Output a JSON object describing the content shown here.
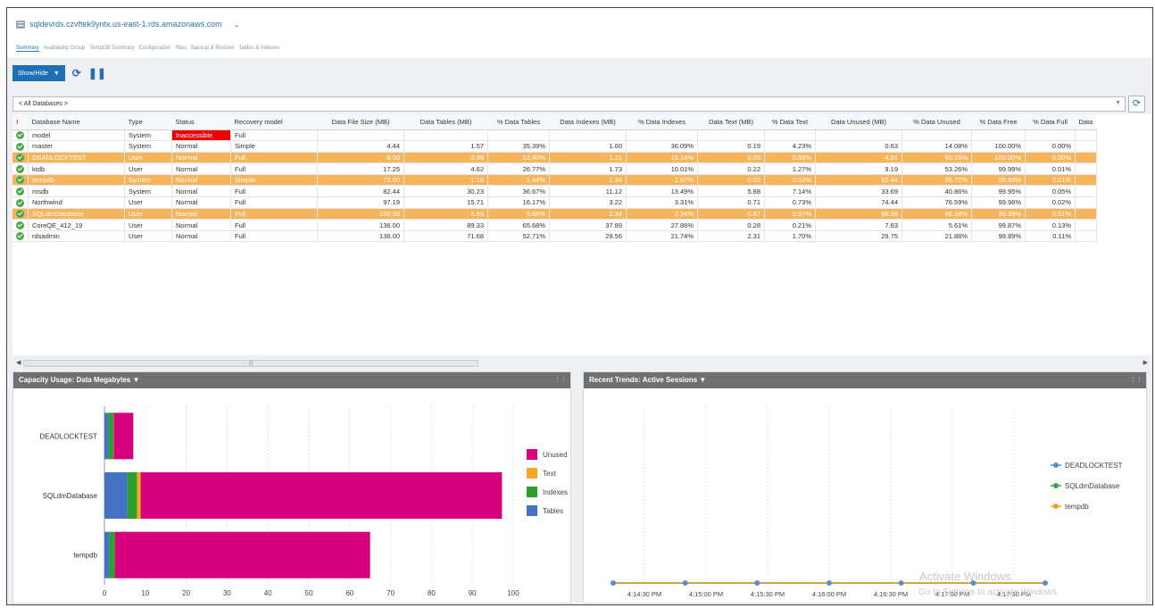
{
  "header": {
    "server": "sqldevrds.czvftek9yntx.us-east-1.rds.amazonaws.com",
    "tabs": [
      "Summary",
      "Availability Group",
      "TempDB Summary",
      "Configuration",
      "Files",
      "Backup & Restore",
      "Tables & Indexes"
    ],
    "active_tab": "Summary"
  },
  "toolbar": {
    "showhide_label": "Show/Hide",
    "refresh_icon": "refresh-icon",
    "pause_icon": "pause-icon"
  },
  "db_selector": {
    "value": "< All Databases >"
  },
  "table": {
    "columns": [
      "Database Name",
      "Type",
      "Status",
      "Recovery model",
      "Data File Size (MB)",
      "Data Tables (MB)",
      "% Data Tables",
      "Data Indexes (MB)",
      "% Data Indexes",
      "Data Text (MB)",
      "% Data Text",
      "Data Unused (MB)",
      "% Data Unused",
      "% Data Free",
      "% Data Full",
      "Data"
    ],
    "rows": [
      {
        "name": "model",
        "type": "System",
        "status": "Inaccessible",
        "recovery": "Full",
        "file_size": "",
        "tables": "",
        "pct_tables": "",
        "indexes": "",
        "pct_indexes": "",
        "text": "",
        "pct_text": "",
        "unused": "",
        "pct_unused": "",
        "pct_free": "",
        "pct_full": "",
        "highlight": false,
        "inaccessible": true
      },
      {
        "name": "master",
        "type": "System",
        "status": "Normal",
        "recovery": "Simple",
        "file_size": "4.44",
        "tables": "1.57",
        "pct_tables": "35.39%",
        "indexes": "1.60",
        "pct_indexes": "36.09%",
        "text": "0.19",
        "pct_text": "4.23%",
        "unused": "0.63",
        "pct_unused": "14.08%",
        "pct_free": "100.00%",
        "pct_full": "0.00%",
        "highlight": false
      },
      {
        "name": "DEADLOCKTEST",
        "type": "User",
        "status": "Normal",
        "recovery": "Full",
        "file_size": "8.00",
        "tables": "0.99",
        "pct_tables": "12.40%",
        "indexes": "1.21",
        "pct_indexes": "15.14%",
        "text": "0.05",
        "pct_text": "0.59%",
        "unused": "4.81",
        "pct_unused": "60.16%",
        "pct_free": "100.00%",
        "pct_full": "0.00%",
        "highlight": true
      },
      {
        "name": "ktdb",
        "type": "User",
        "status": "Normal",
        "recovery": "Full",
        "file_size": "17.25",
        "tables": "4.62",
        "pct_tables": "26.77%",
        "indexes": "1.73",
        "pct_indexes": "10.01%",
        "text": "0.22",
        "pct_text": "1.27%",
        "unused": "9.19",
        "pct_unused": "53.26%",
        "pct_free": "99.99%",
        "pct_full": "0.01%",
        "highlight": false
      },
      {
        "name": "tempdb",
        "type": "System",
        "status": "Normal",
        "recovery": "Simple",
        "file_size": "72.00",
        "tables": "1.18",
        "pct_tables": "1.64%",
        "indexes": "1.34",
        "pct_indexes": "1.87%",
        "text": "0.02",
        "pct_text": "0.03%",
        "unused": "62.44",
        "pct_unused": "86.72%",
        "pct_free": "99.99%",
        "pct_full": "0.01%",
        "highlight": true
      },
      {
        "name": "msdb",
        "type": "System",
        "status": "Normal",
        "recovery": "Full",
        "file_size": "82.44",
        "tables": "30.23",
        "pct_tables": "36.67%",
        "indexes": "11.12",
        "pct_indexes": "13.49%",
        "text": "5.88",
        "pct_text": "7.14%",
        "unused": "33.69",
        "pct_unused": "40.86%",
        "pct_free": "99.95%",
        "pct_full": "0.05%",
        "highlight": false
      },
      {
        "name": "Northwind",
        "type": "User",
        "status": "Normal",
        "recovery": "Full",
        "file_size": "97.19",
        "tables": "15.71",
        "pct_tables": "16.17%",
        "indexes": "3.22",
        "pct_indexes": "3.31%",
        "text": "0.71",
        "pct_text": "0.73%",
        "unused": "74.44",
        "pct_unused": "76.59%",
        "pct_free": "99.98%",
        "pct_full": "0.02%",
        "highlight": false
      },
      {
        "name": "SQLdmDatabase",
        "type": "User",
        "status": "Normal",
        "recovery": "Full",
        "file_size": "100.00",
        "tables": "5.65",
        "pct_tables": "5.65%",
        "indexes": "2.34",
        "pct_indexes": "2.34%",
        "text": "0.87",
        "pct_text": "0.87%",
        "unused": "88.38",
        "pct_unused": "88.38%",
        "pct_free": "99.99%",
        "pct_full": "0.01%",
        "highlight": true
      },
      {
        "name": "CoreQE_412_19",
        "type": "User",
        "status": "Normal",
        "recovery": "Full",
        "file_size": "136.00",
        "tables": "89.33",
        "pct_tables": "65.68%",
        "indexes": "37.89",
        "pct_indexes": "27.86%",
        "text": "0.28",
        "pct_text": "0.21%",
        "unused": "7.63",
        "pct_unused": "5.61%",
        "pct_free": "99.87%",
        "pct_full": "0.13%",
        "highlight": false
      },
      {
        "name": "rdsadmin",
        "type": "User",
        "status": "Normal",
        "recovery": "Full",
        "file_size": "136.00",
        "tables": "71.68",
        "pct_tables": "52.71%",
        "indexes": "29.56",
        "pct_indexes": "21.74%",
        "text": "2.31",
        "pct_text": "1.70%",
        "unused": "29.75",
        "pct_unused": "21.88%",
        "pct_free": "99.89%",
        "pct_full": "0.11%",
        "highlight": false
      }
    ]
  },
  "capacity_panel": {
    "title": "Capacity Usage: Data Megabytes"
  },
  "trends_panel": {
    "title": "Recent Trends: Active Sessions"
  },
  "chart_data": [
    {
      "type": "bar",
      "orientation": "horizontal",
      "stacked": true,
      "categories": [
        "DEADLOCKTEST",
        "SQLdmDatabase",
        "tempdb"
      ],
      "series": [
        {
          "name": "Tables",
          "color": "#4472c4",
          "values": [
            0.99,
            5.65,
            1.18
          ]
        },
        {
          "name": "Indexes",
          "color": "#2ca02c",
          "values": [
            1.21,
            2.34,
            1.34
          ]
        },
        {
          "name": "Text",
          "color": "#f5a623",
          "values": [
            0.05,
            0.87,
            0.02
          ]
        },
        {
          "name": "Unused",
          "color": "#d6007e",
          "values": [
            4.81,
            88.38,
            62.44
          ]
        }
      ],
      "xlim": [
        0,
        100
      ],
      "xticks": [
        0,
        10,
        20,
        30,
        40,
        50,
        60,
        70,
        80,
        90,
        100
      ],
      "legend": "right"
    },
    {
      "type": "line",
      "x": [
        "4:14:30 PM",
        "4:15:00 PM",
        "4:15:30 PM",
        "4:16:00 PM",
        "4:16:30 PM",
        "4:17:00 PM",
        "4:17:30 PM"
      ],
      "series": [
        {
          "name": "DEADLOCKTEST",
          "color": "#5b8fc7",
          "values": [
            0,
            0,
            0,
            0,
            0,
            0,
            0,
            0,
            0,
            0,
            0,
            0,
            0
          ]
        },
        {
          "name": "SQLdmDatabase",
          "color": "#3fa34d",
          "values": [
            0,
            0,
            0,
            0,
            0,
            0,
            0,
            0,
            0,
            0,
            0,
            0,
            0
          ]
        },
        {
          "name": "tempdb",
          "color": "#f0a030",
          "values": [
            0,
            0,
            0,
            0,
            0,
            0,
            0,
            0,
            0,
            0,
            0,
            0,
            0
          ]
        }
      ],
      "legend": "right"
    }
  ],
  "watermark": {
    "line1": "Activate Windows",
    "line2": "Go to Settings to activate Windows."
  }
}
